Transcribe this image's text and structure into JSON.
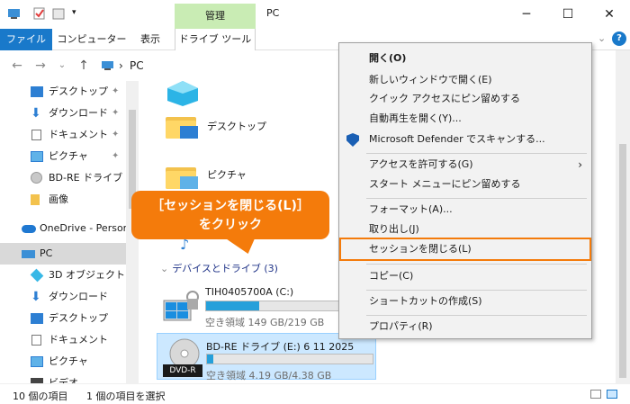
{
  "window": {
    "title": "PC",
    "context_tab": "管理"
  },
  "ribbon": {
    "tabs": [
      "ファイル",
      "コンピューター",
      "表示",
      "ドライブ ツール"
    ]
  },
  "address": {
    "path": "PC"
  },
  "nav": {
    "items": [
      {
        "label": "デスクトップ",
        "pinned": true
      },
      {
        "label": "ダウンロード",
        "pinned": true
      },
      {
        "label": "ドキュメント",
        "pinned": true
      },
      {
        "label": "ピクチャ",
        "pinned": true
      },
      {
        "label": "BD-RE ドライブ (E:)"
      },
      {
        "label": "画像"
      },
      {
        "label": "OneDrive - Personal"
      },
      {
        "label": "PC"
      },
      {
        "label": "3D オブジェクト"
      },
      {
        "label": "ダウンロード"
      },
      {
        "label": "デスクトップ"
      },
      {
        "label": "ドキュメント"
      },
      {
        "label": "ピクチャ"
      },
      {
        "label": "ビデオ"
      }
    ]
  },
  "content": {
    "folders": [
      "デスクトップ",
      "ピクチャ"
    ],
    "section_header": "デバイスとドライブ (3)",
    "drives": [
      {
        "name": "TIH0405700A (C:)",
        "free": "空き領域 149 GB/219 GB",
        "used_fraction": 0.32
      },
      {
        "name": "BD-RE ドライブ (E:) 6 11 2025",
        "free": "空き領域 4.19 GB/4.38 GB",
        "used_fraction": 0.04,
        "badge": "DVD-R"
      }
    ]
  },
  "status": {
    "item_count": "10 個の項目",
    "selected": "1 個の項目を選択"
  },
  "callout": {
    "line1": "［セッションを閉じる(L)］",
    "line2": "をクリック"
  },
  "menu": {
    "items": [
      {
        "label": "開く(O)",
        "bold": true
      },
      {
        "label": "新しいウィンドウで開く(E)"
      },
      {
        "label": "クイック アクセスにピン留めする"
      },
      {
        "label": "自動再生を開く(Y)..."
      },
      {
        "label": "Microsoft Defender でスキャンする..."
      },
      {
        "label": "アクセスを許可する(G)"
      },
      {
        "label": "スタート メニューにピン留めする"
      },
      {
        "label": "フォーマット(A)..."
      },
      {
        "label": "取り出し(J)"
      },
      {
        "label": "セッションを閉じる(L)"
      },
      {
        "label": "コピー(C)"
      },
      {
        "label": "ショートカットの作成(S)"
      },
      {
        "label": "プロパティ(R)"
      }
    ]
  },
  "colors": {
    "accent": "#1979ca",
    "callout": "#f47b0b",
    "context_tab": "#c9ecb4"
  }
}
